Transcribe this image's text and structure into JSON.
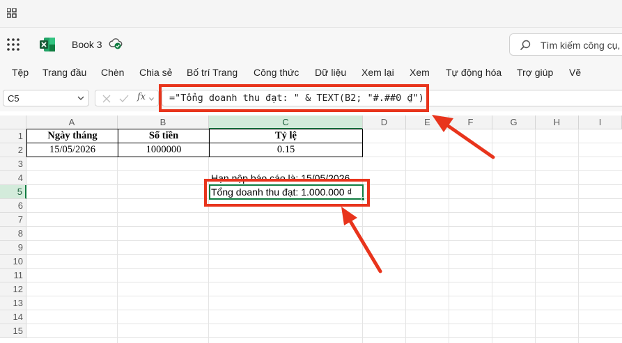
{
  "app": {
    "title": "Book 3",
    "search_placeholder": "Tìm kiếm công cụ,"
  },
  "ribbon": {
    "tabs": [
      "Tệp",
      "Trang đầu",
      "Chèn",
      "Chia sẻ",
      "Bố trí Trang",
      "Công thức",
      "Dữ liệu",
      "Xem lại",
      "Xem",
      "Tự động hóa",
      "Trợ giúp",
      "Vẽ"
    ]
  },
  "formula_bar": {
    "name_box": "C5",
    "fx_label": "fx",
    "formula": "=\"Tổng doanh thu đạt: \" & TEXT(B2; \"#.##0 ₫\")"
  },
  "grid": {
    "columns": [
      "A",
      "B",
      "C",
      "D",
      "E",
      "F",
      "G",
      "H",
      "I"
    ],
    "rows": [
      "1",
      "2",
      "3",
      "4",
      "5",
      "6",
      "7",
      "8",
      "9",
      "10",
      "11",
      "12",
      "13",
      "14",
      "15"
    ],
    "selected_column": "C",
    "selected_row": "5"
  },
  "table": {
    "headers": [
      "Ngày tháng",
      "Số tiền",
      "Tỷ lệ"
    ],
    "row": [
      "15/05/2026",
      "1000000",
      "0.15"
    ]
  },
  "cells": {
    "c4": "Hạn nộp báo cáo là: 15/05/2026",
    "c5": "Tổng doanh thu đạt: 1.000.000 ₫"
  },
  "colors": {
    "excel_green": "#107c41",
    "annotation_red": "#e8341c"
  }
}
